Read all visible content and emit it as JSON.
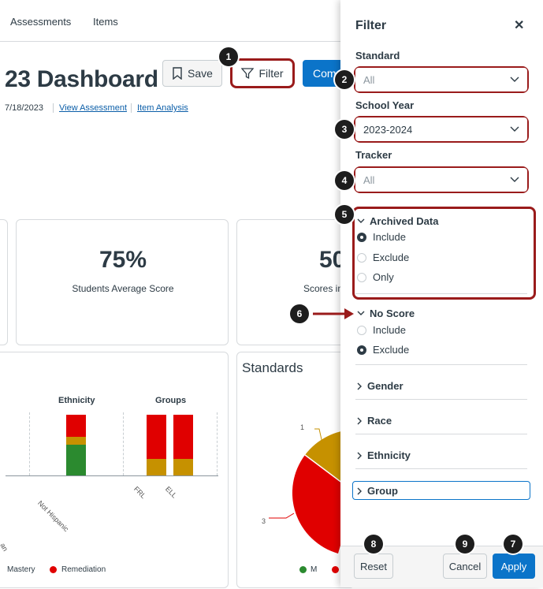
{
  "nav": {
    "items": [
      "Assessments",
      "Items"
    ]
  },
  "header": {
    "title": "23 Dashboard",
    "save_label": "Save",
    "filter_label": "Filter",
    "compare_label": "Com"
  },
  "meta": {
    "date": "7/18/2023",
    "view_assessment": "View Assessment",
    "item_analysis": "Item Analysis"
  },
  "stats": [
    {
      "value": "75%",
      "label": "Students Average Score"
    },
    {
      "value": "50",
      "label": "Scores in"
    }
  ],
  "demographics_chart": {
    "ethnicity_label": "Ethnicity",
    "groups_label": "Groups",
    "x_labels": [
      "Not Hispanic",
      "FRL",
      "ELL"
    ],
    "left_cut_label": "an",
    "legend": [
      "Mastery",
      "Remediation"
    ]
  },
  "standards_chart": {
    "title": "Standards",
    "slice_labels": [
      "1",
      "3"
    ],
    "legend": [
      "M"
    ]
  },
  "colors": {
    "mastery": "#2b8a2f",
    "near": "#c69100",
    "remediation": "#e00000",
    "accent": "#0b74c9",
    "highlight": "#9a1b1b"
  },
  "filter_panel": {
    "title": "Filter",
    "close_icon": "close-icon",
    "standard": {
      "label": "Standard",
      "value": "All"
    },
    "school_year": {
      "label": "School Year",
      "value": "2023-2024"
    },
    "tracker": {
      "label": "Tracker",
      "value": "All"
    },
    "archived_data": {
      "label": "Archived Data",
      "options": [
        "Include",
        "Exclude",
        "Only"
      ],
      "selected": "Include"
    },
    "no_score": {
      "label": "No Score",
      "options": [
        "Include",
        "Exclude"
      ],
      "selected": "Exclude"
    },
    "collapsed_sections": [
      "Gender",
      "Race",
      "Ethnicity",
      "Group"
    ],
    "reset_label": "Reset",
    "cancel_label": "Cancel",
    "apply_label": "Apply"
  },
  "callouts": [
    "1",
    "2",
    "3",
    "4",
    "5",
    "6",
    "7",
    "8",
    "9"
  ]
}
